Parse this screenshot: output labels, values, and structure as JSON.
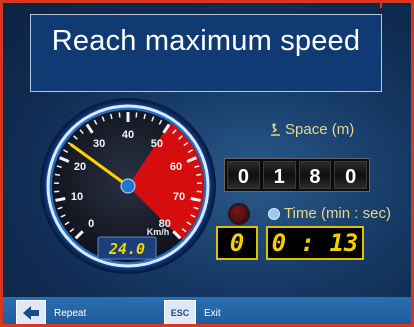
{
  "title": "Reach maximum speed",
  "gauge": {
    "ticks": [
      "0",
      "10",
      "20",
      "30",
      "40",
      "50",
      "60",
      "70",
      "80"
    ],
    "unit": "Km/h",
    "readout": "24.0",
    "needle_value": 24,
    "max_value": 80,
    "danger_from": 50,
    "colors": {
      "needle": "#ffd100",
      "danger": "#d60d0d",
      "ring": "#1f76d3"
    }
  },
  "space": {
    "label": "Space (m)",
    "digits": [
      "0",
      "1",
      "8",
      "0"
    ]
  },
  "time": {
    "label": "Time (min : sec)",
    "minutes": "0",
    "seconds": "0 : 13"
  },
  "toolbar": {
    "repeat_label": "Repeat",
    "repeat_icon": "arrow-left-icon",
    "exit_label": "Exit",
    "exit_key": "ESC"
  }
}
